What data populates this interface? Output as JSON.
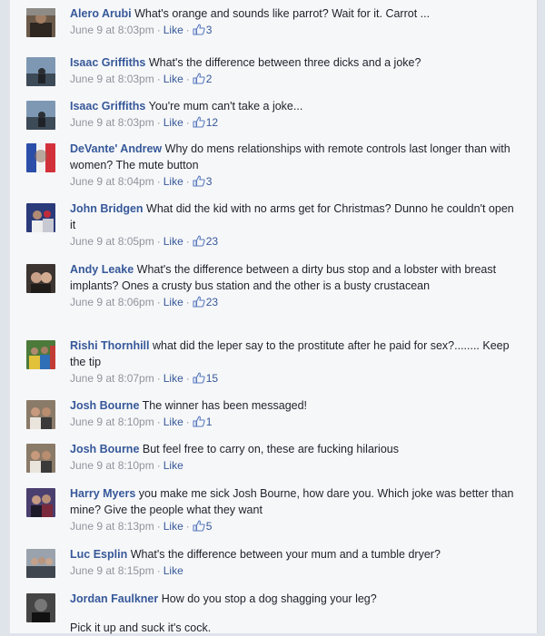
{
  "comments": [
    {
      "author": "Alero Arubi",
      "text": "What's orange and sounds like parrot? Wait for it. Carrot ...",
      "time": "June 9 at 8:03pm",
      "like": "Like",
      "likes": "3"
    },
    {
      "author": "Isaac Griffiths",
      "text": "What's the difference between three dicks and a joke?",
      "time": "June 9 at 8:03pm",
      "like": "Like",
      "likes": "2"
    },
    {
      "author": "Isaac Griffiths",
      "text": "You're mum can't take a joke...",
      "time": "June 9 at 8:03pm",
      "like": "Like",
      "likes": "12"
    },
    {
      "author": "DeVante' Andrew",
      "text": "Why do mens relationships with remote controls last longer than with women? The mute button",
      "time": "June 9 at 8:04pm",
      "like": "Like",
      "likes": "3"
    },
    {
      "author": "John Bridgen",
      "text": "What did the kid with no arms get for Christmas? Dunno he couldn't open it",
      "time": "June 9 at 8:05pm",
      "like": "Like",
      "likes": "23"
    },
    {
      "author": "Andy Leake",
      "text": "What's the difference between a dirty bus stop and a lobster with breast implants? Ones a crusty bus station and the other is a busty crustacean",
      "time": "June 9 at 8:06pm",
      "like": "Like",
      "likes": "23"
    },
    {
      "author": "Rishi Thornhill",
      "text": "what did the leper say to the prostitute after he paid for sex?........ Keep the tip",
      "time": "June 9 at 8:07pm",
      "like": "Like",
      "likes": "15"
    },
    {
      "author": "Josh Bourne",
      "text": "The winner has been messaged!",
      "time": "June 9 at 8:10pm",
      "like": "Like",
      "likes": "1"
    },
    {
      "author": "Josh Bourne",
      "text": "But feel free to carry on, these are fucking hilarious",
      "time": "June 9 at 8:10pm",
      "like": "Like",
      "likes": ""
    },
    {
      "author": "Harry Myers",
      "text": "you make me sick Josh Bourne, how dare you. Which joke was better than mine? Give the people what they want",
      "time": "June 9 at 8:13pm",
      "like": "Like",
      "likes": "5"
    },
    {
      "author": "Luc Esplin",
      "text": "What's the difference between your mum and a tumble dryer?",
      "time": "June 9 at 8:15pm",
      "like": "Like",
      "likes": ""
    },
    {
      "author": "Jordan Faulkner",
      "text": "How do you stop a dog shagging your leg?",
      "time": "",
      "like": "",
      "likes": "",
      "extra": "Pick it up and suck it's cock."
    }
  ],
  "colors": {
    "link": "#365899",
    "meta": "#90949c",
    "text": "#1d2129",
    "background": "#f6f7f9"
  },
  "icons": {
    "like_count": "thumbs-up-icon",
    "separator": "middle-dot"
  }
}
